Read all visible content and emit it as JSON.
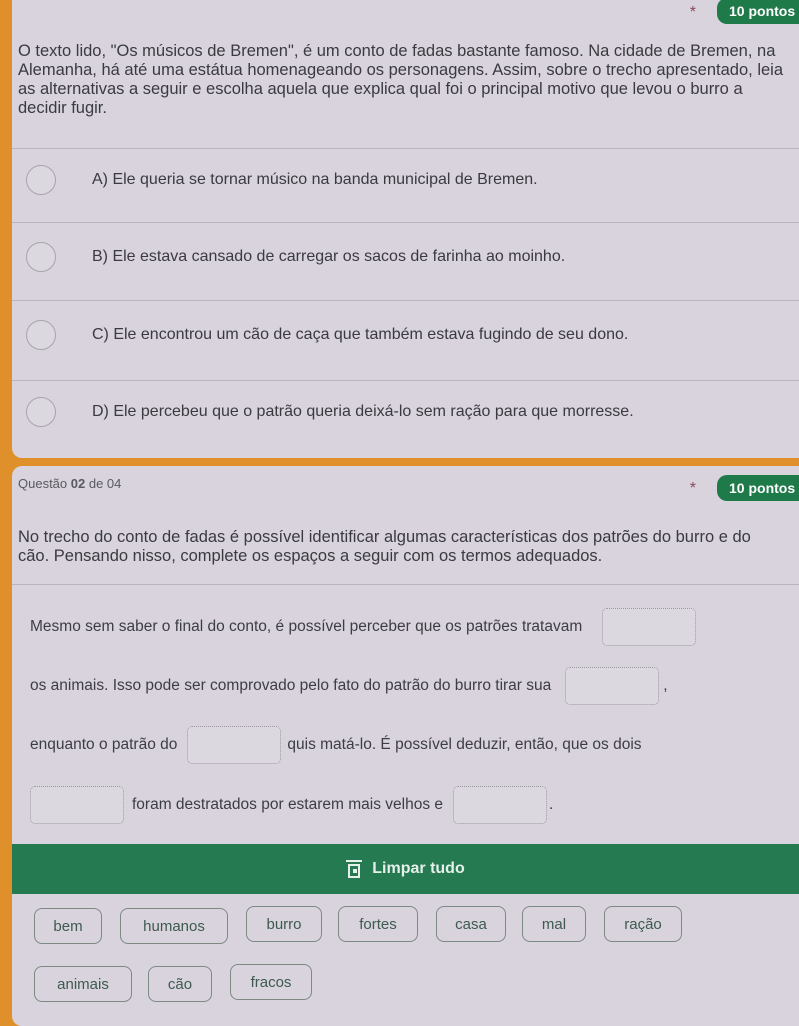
{
  "question1": {
    "points_badge": "10 pontos",
    "required_mark": "*",
    "prompt": "O texto lido, \"Os músicos de Bremen\", é um conto de fadas bastante famoso. Na cidade de Bremen, na Alemanha, há até uma estátua homenageando os personagens. Assim, sobre o trecho apresentado, leia as alternativas a seguir e escolha aquela que explica qual foi o principal motivo que levou o burro a decidir fugir.",
    "options": [
      {
        "label": "A) Ele queria se tornar músico na banda municipal de Bremen."
      },
      {
        "label": "B) Ele estava cansado de carregar os sacos de farinha ao moinho."
      },
      {
        "label": "C) Ele encontrou um cão de caça que também estava fugindo de seu dono."
      },
      {
        "label": "D) Ele percebeu que o patrão queria deixá-lo sem ração para que morresse."
      }
    ]
  },
  "question2": {
    "number_prefix": "Questão ",
    "number": "02",
    "number_suffix": " de 04",
    "required_mark": "*",
    "points_badge": "10 pontos",
    "prompt": "No trecho do conto de fadas é possível identificar algumas características dos patrões do burro e do cão. Pensando nisso, complete os espaços a seguir com os termos adequados.",
    "fill_text": {
      "line1": "Mesmo sem saber o final do conto, é possível perceber que os patrões tratavam",
      "line2": "os animais. Isso pode ser comprovado pelo fato do patrão do burro tirar sua",
      "line2_end": ",",
      "line3_start": "enquanto o patrão do",
      "line3_end": "quis matá-lo. É possível deduzir, então, que os dois",
      "line4_mid": "foram destratados por estarem mais velhos e",
      "line4_end": "."
    },
    "clear_button": "Limpar tudo",
    "word_bank": [
      "bem",
      "humanos",
      "burro",
      "fortes",
      "casa",
      "mal",
      "ração",
      "animais",
      "cão",
      "fracos"
    ]
  }
}
